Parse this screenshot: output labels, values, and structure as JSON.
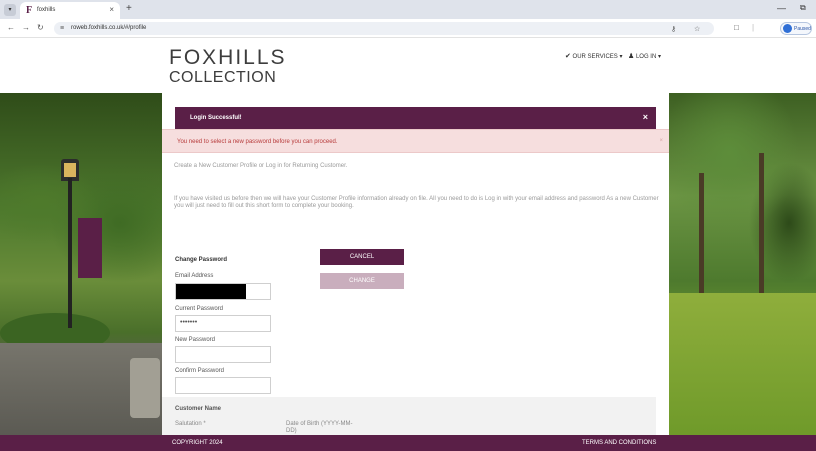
{
  "browser": {
    "tab_title": "foxhills",
    "tab_favicon": "F",
    "url": "roweb.foxhills.co.uk/#/profile",
    "profile_label": "Paused",
    "icons": {
      "tab_menu": "chevron-down-icon",
      "close": "close-icon",
      "new_tab": "plus-icon",
      "back": "back-arrow-icon",
      "forward": "forward-arrow-icon",
      "reload": "reload-icon",
      "site_info": "tune-icon",
      "password_key": "key-icon",
      "bookmark": "star-icon",
      "extensions": "puzzle-icon",
      "minimize": "minimize-icon",
      "maximize": "maximize-icon"
    }
  },
  "header": {
    "logo_line1": "FOXHILLS",
    "logo_line2": "COLLECTION",
    "nav_services": "OUR SERVICES",
    "nav_login": "LOG IN"
  },
  "alerts": {
    "success": "Login Successful!",
    "warning": "You need to select a new password before you can proceed."
  },
  "intro_text": "Create a New Customer Profile or Log in for Returning Customer.",
  "paragraph": "If you have visited us before then we will have your Customer Profile information already on file. All you need to do is Log in with your email address and password As a new Customer you will just need to fill out this short form to complete your booking.",
  "change_password": {
    "heading": "Change Password",
    "email_label": "Email Address",
    "current_label": "Current Password",
    "current_value": "•••••••",
    "new_label": "New Password",
    "confirm_label": "Confirm Password",
    "cancel_button": "CANCEL",
    "change_button": "CHANGE"
  },
  "customer": {
    "heading": "Customer Name",
    "salutation_label": "Salutation *",
    "dob_label": "Date of Birth (YYYY-MM-DD)"
  },
  "footer": {
    "copyright": "COPYRIGHT 2024",
    "terms": "TERMS AND CONDITIONS"
  },
  "colors": {
    "brand": "#5a1f47",
    "brand_light": "#c9aebd",
    "warning_bg": "#f6dede",
    "warning_text": "#b73b3b"
  }
}
